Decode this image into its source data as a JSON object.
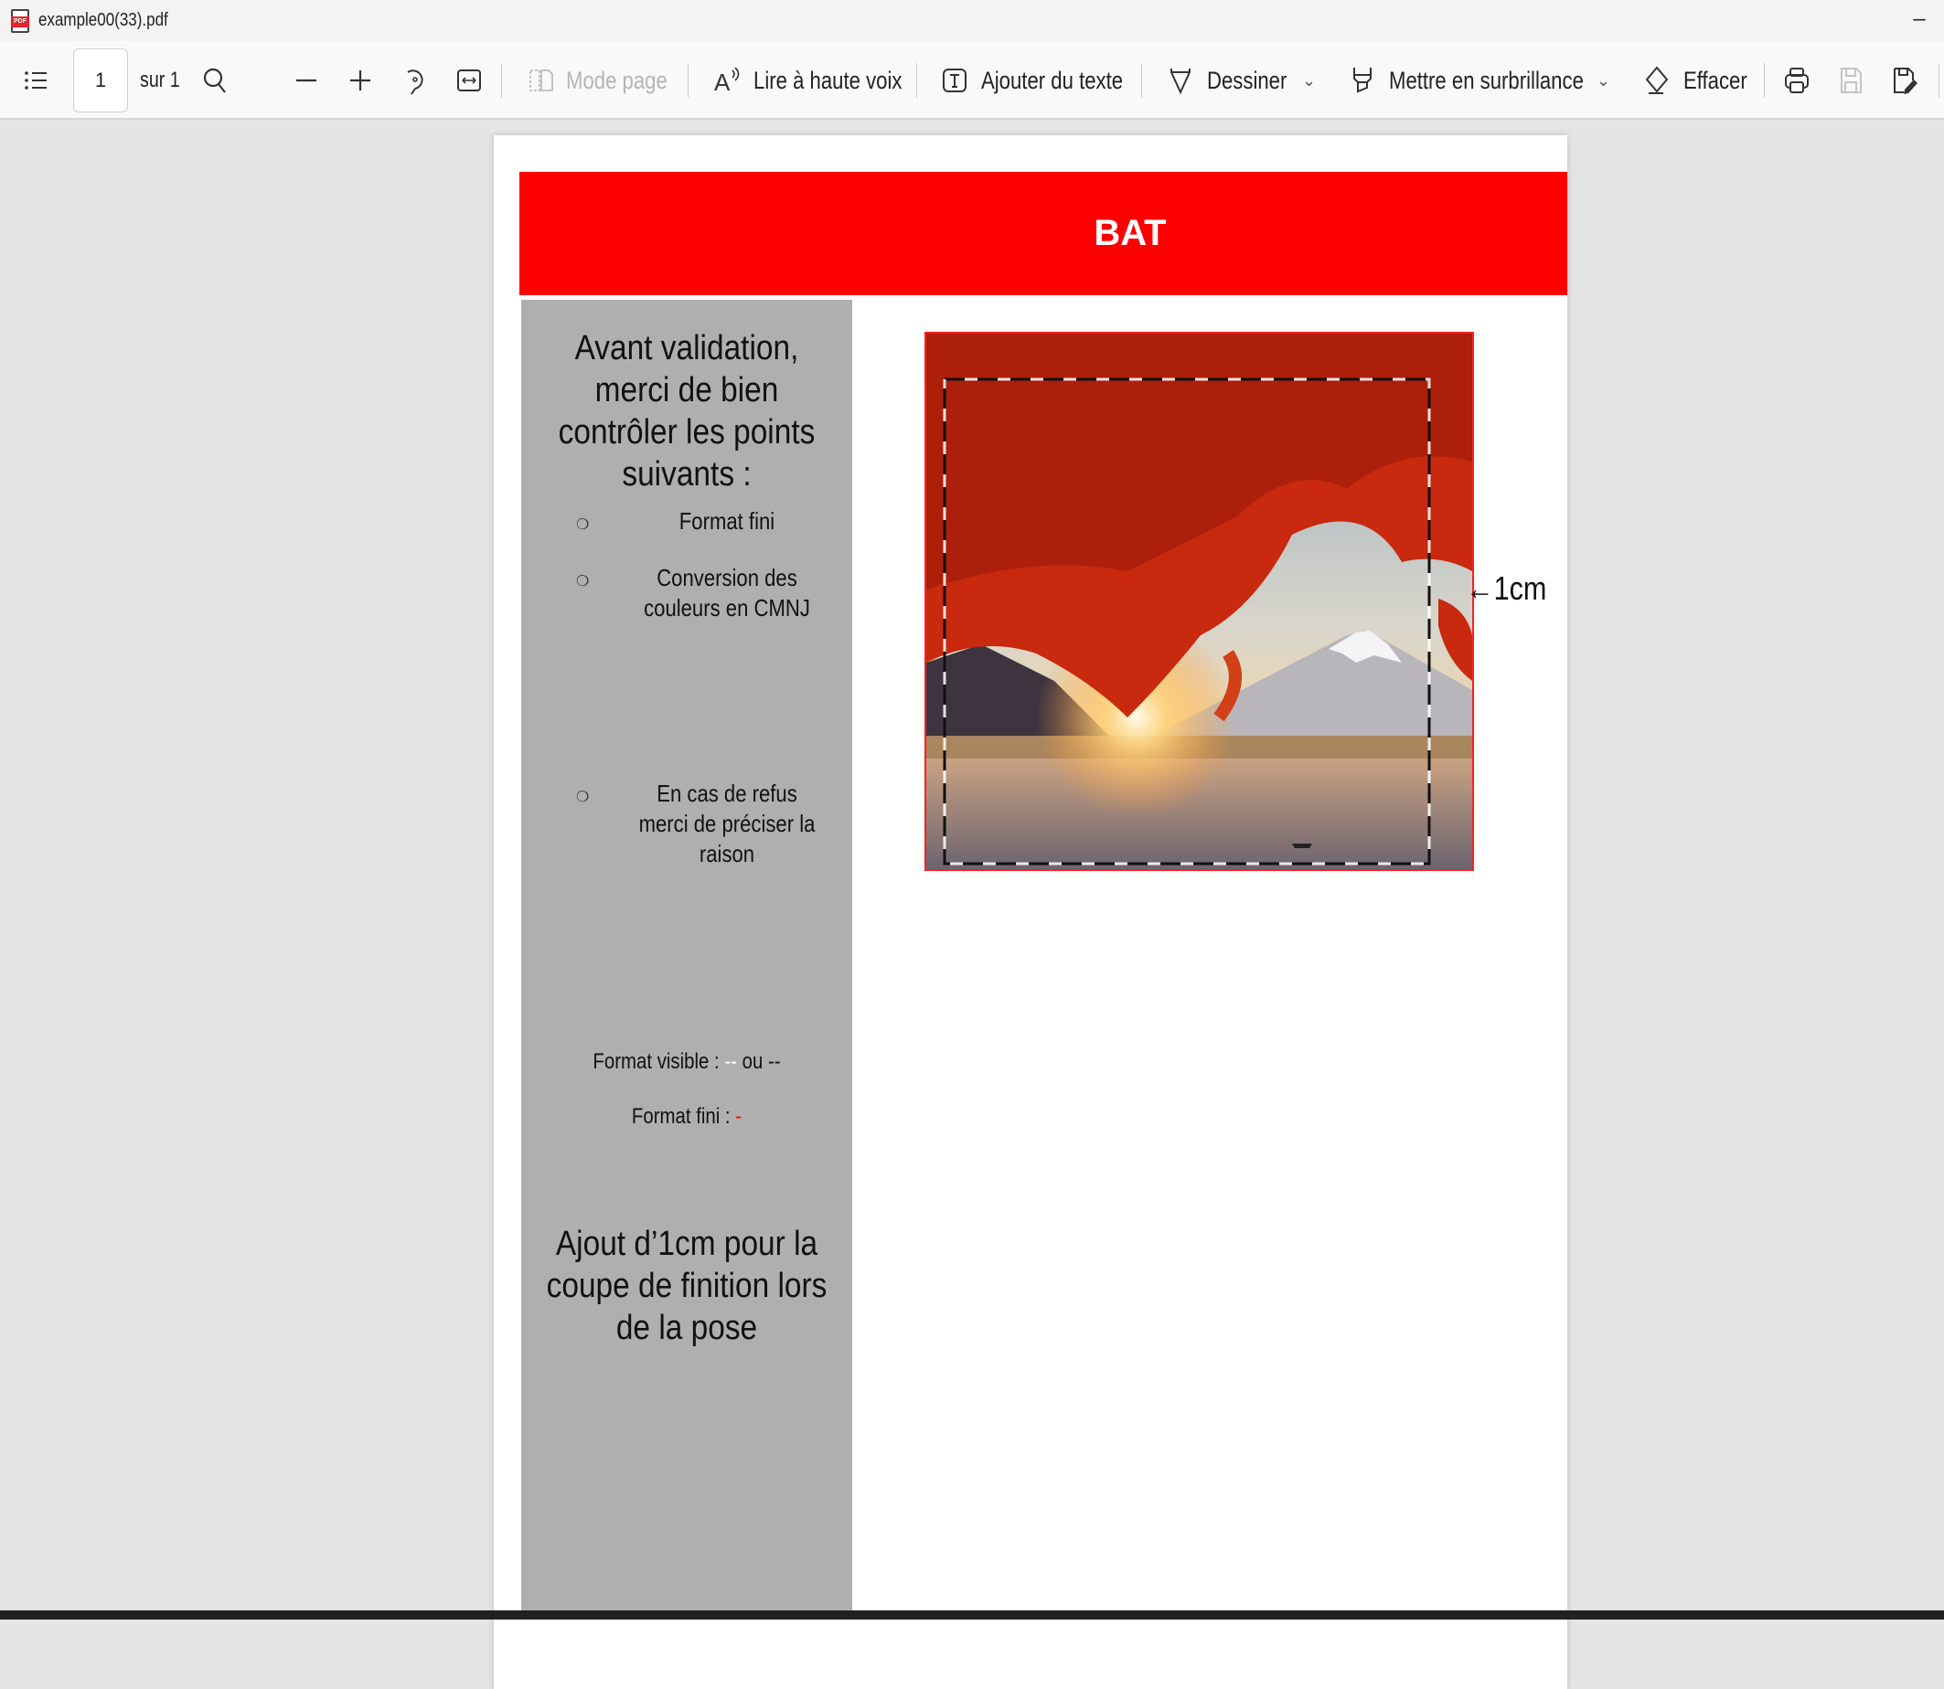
{
  "window": {
    "title": "example00(33).pdf",
    "minimize_label": "–"
  },
  "toolbar": {
    "page_current": "1",
    "page_total_label": "sur 1",
    "page_mode_label": "Mode page",
    "read_aloud_label": "Lire à haute voix",
    "add_text_label": "Ajouter du texte",
    "draw_label": "Dessiner",
    "highlight_label": "Mettre en surbrillance",
    "erase_label": "Effacer",
    "chevron": "⌄"
  },
  "document": {
    "header_title": "BAT",
    "panel": {
      "heading": "Avant validation, merci de bien contrôler les points suivants :",
      "bullet_glyph": "❍",
      "items": [
        "Format fini",
        "Conversion des couleurs en CMNJ",
        "En cas de refus merci de préciser la raison"
      ],
      "format_visible_label": "Format visible : ",
      "format_visible_dash1": "--",
      "format_visible_or": " ou ",
      "format_visible_dash2": "--",
      "format_fini_label": "Format fini : ",
      "format_fini_dash": "-",
      "footer_note": "Ajout d’1cm pour la coupe de finition lors de la pose"
    },
    "bleed_label": "←1cm",
    "colors": {
      "header_red": "#ff0000",
      "panel_gray": "#afafaf"
    }
  }
}
